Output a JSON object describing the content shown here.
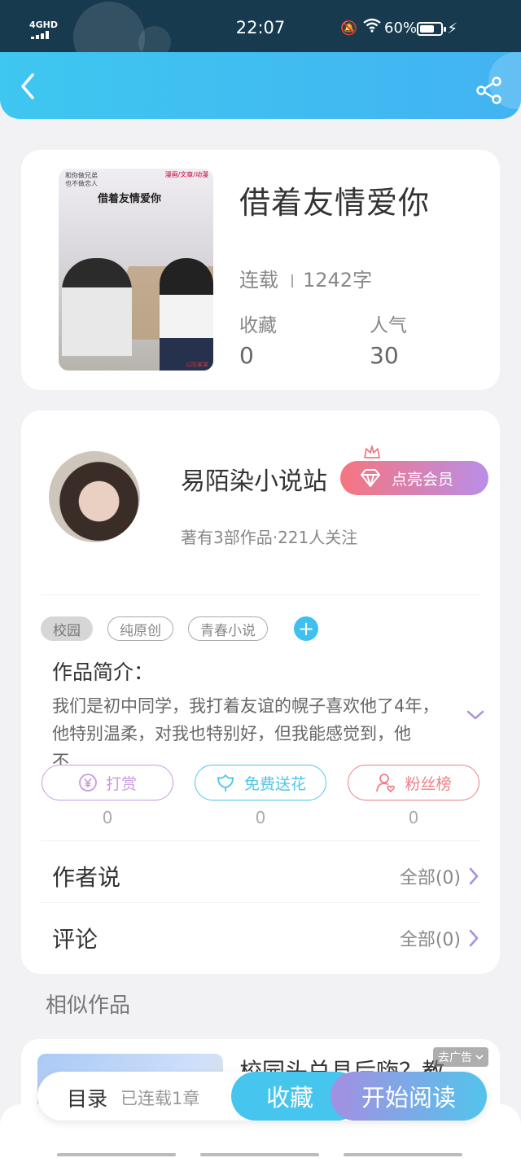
{
  "status_bar": {
    "network": "4GHD",
    "time": "22:07",
    "battery": "60%"
  },
  "header": {
    "back_icon": "chevron-left-icon",
    "share_icon": "share-icon"
  },
  "book": {
    "cover_line1": "和你做兄弟",
    "cover_line2": "也不做恋人",
    "cover_publisher": "漫画/文章/动漫",
    "cover_title": "借着友情爱你",
    "cover_stamp": "以防某某",
    "title": "借着友情爱你",
    "status": "连载",
    "word_count": "1242字",
    "stats": [
      {
        "label": "收藏",
        "value": "0"
      },
      {
        "label": "人气",
        "value": "30"
      }
    ]
  },
  "author": {
    "name": "易陌染小说站",
    "vip_label": "点亮会员",
    "meta": "著有3部作品·221人关注"
  },
  "tags": [
    "校园",
    "纯原创",
    "青春小说"
  ],
  "intro": {
    "title": "作品简介：",
    "text": "我们是初中同学，我打着友谊的幌子喜欢他了4年，他特别温柔，对我也特别好，但我能感觉到，他不…"
  },
  "actions": [
    {
      "label": "打赏",
      "icon": "yen-coin-icon",
      "count": "0",
      "color": "#c79ae0"
    },
    {
      "label": "免费送花",
      "icon": "flower-icon",
      "count": "0",
      "color": "#4cc7e8"
    },
    {
      "label": "粉丝榜",
      "icon": "fan-user-icon",
      "count": "0",
      "color": "#ef7f86"
    }
  ],
  "rows": [
    {
      "title": "作者说",
      "link": "全部(0)"
    },
    {
      "title": "评论",
      "link": "全部(0)"
    }
  ],
  "similar": {
    "title": "相似作品",
    "first_title": "校园头兑县后嗨？教",
    "ad_label": "去广告"
  },
  "bottom_bar": {
    "toc_label": "目录",
    "toc_sub": "已连载1章",
    "fav_label": "收藏",
    "read_label": "开始阅读"
  }
}
